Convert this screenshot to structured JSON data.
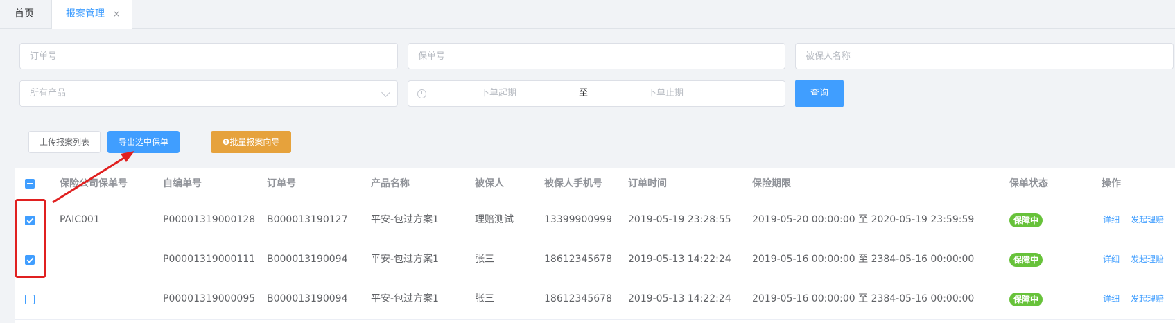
{
  "tabs": [
    {
      "label": "首页"
    },
    {
      "label": "报案管理",
      "close": "×"
    }
  ],
  "filters": {
    "order_no_placeholder": "订单号",
    "policy_no_placeholder": "保单号",
    "insured_name_placeholder": "被保人名称",
    "product_select": "所有产品",
    "date_start_placeholder": "下单起期",
    "date_separator": "至",
    "date_end_placeholder": "下单止期",
    "query_label": "查询"
  },
  "toolbar": {
    "upload_label": "上传报案列表",
    "export_label": "导出选中保单",
    "batch_label": "❶批量报案向导"
  },
  "table": {
    "headers": [
      "保险公司保单号",
      "自编单号",
      "订单号",
      "产品名称",
      "被保人",
      "被保人手机号",
      "订单时间",
      "保险期限",
      "保单状态",
      "操作"
    ],
    "rows": [
      {
        "checked": true,
        "company_policy": "PAIC001",
        "self_no": "P00001319000128",
        "order_no": "B000013190127",
        "product": "平安-包过方案1",
        "insured": "理赔测试",
        "phone": "13399900999",
        "order_time": "2019-05-19 23:28:55",
        "period": "2019-05-20 00:00:00 至 2020-05-19 23:59:59",
        "status": "保障中",
        "action_detail": "详细",
        "action_claim": "发起理赔"
      },
      {
        "checked": true,
        "company_policy": "",
        "self_no": "P00001319000111",
        "order_no": "B000013190094",
        "product": "平安-包过方案1",
        "insured": "张三",
        "phone": "18612345678",
        "order_time": "2019-05-13 14:22:24",
        "period": "2019-05-16 00:00:00 至 2384-05-16 00:00:00",
        "status": "保障中",
        "action_detail": "详细",
        "action_claim": "发起理赔"
      },
      {
        "checked": false,
        "company_policy": "",
        "self_no": "P00001319000095",
        "order_no": "B000013190094",
        "product": "平安-包过方案1",
        "insured": "张三",
        "phone": "18612345678",
        "order_time": "2019-05-13 14:22:24",
        "period": "2019-05-16 00:00:00 至 2384-05-16 00:00:00",
        "status": "保障中",
        "action_detail": "详细",
        "action_claim": "发起理赔"
      }
    ]
  },
  "colors": {
    "primary": "#409eff",
    "warning": "#e6a23c",
    "success": "#67c23a",
    "annotation": "#e02020"
  }
}
